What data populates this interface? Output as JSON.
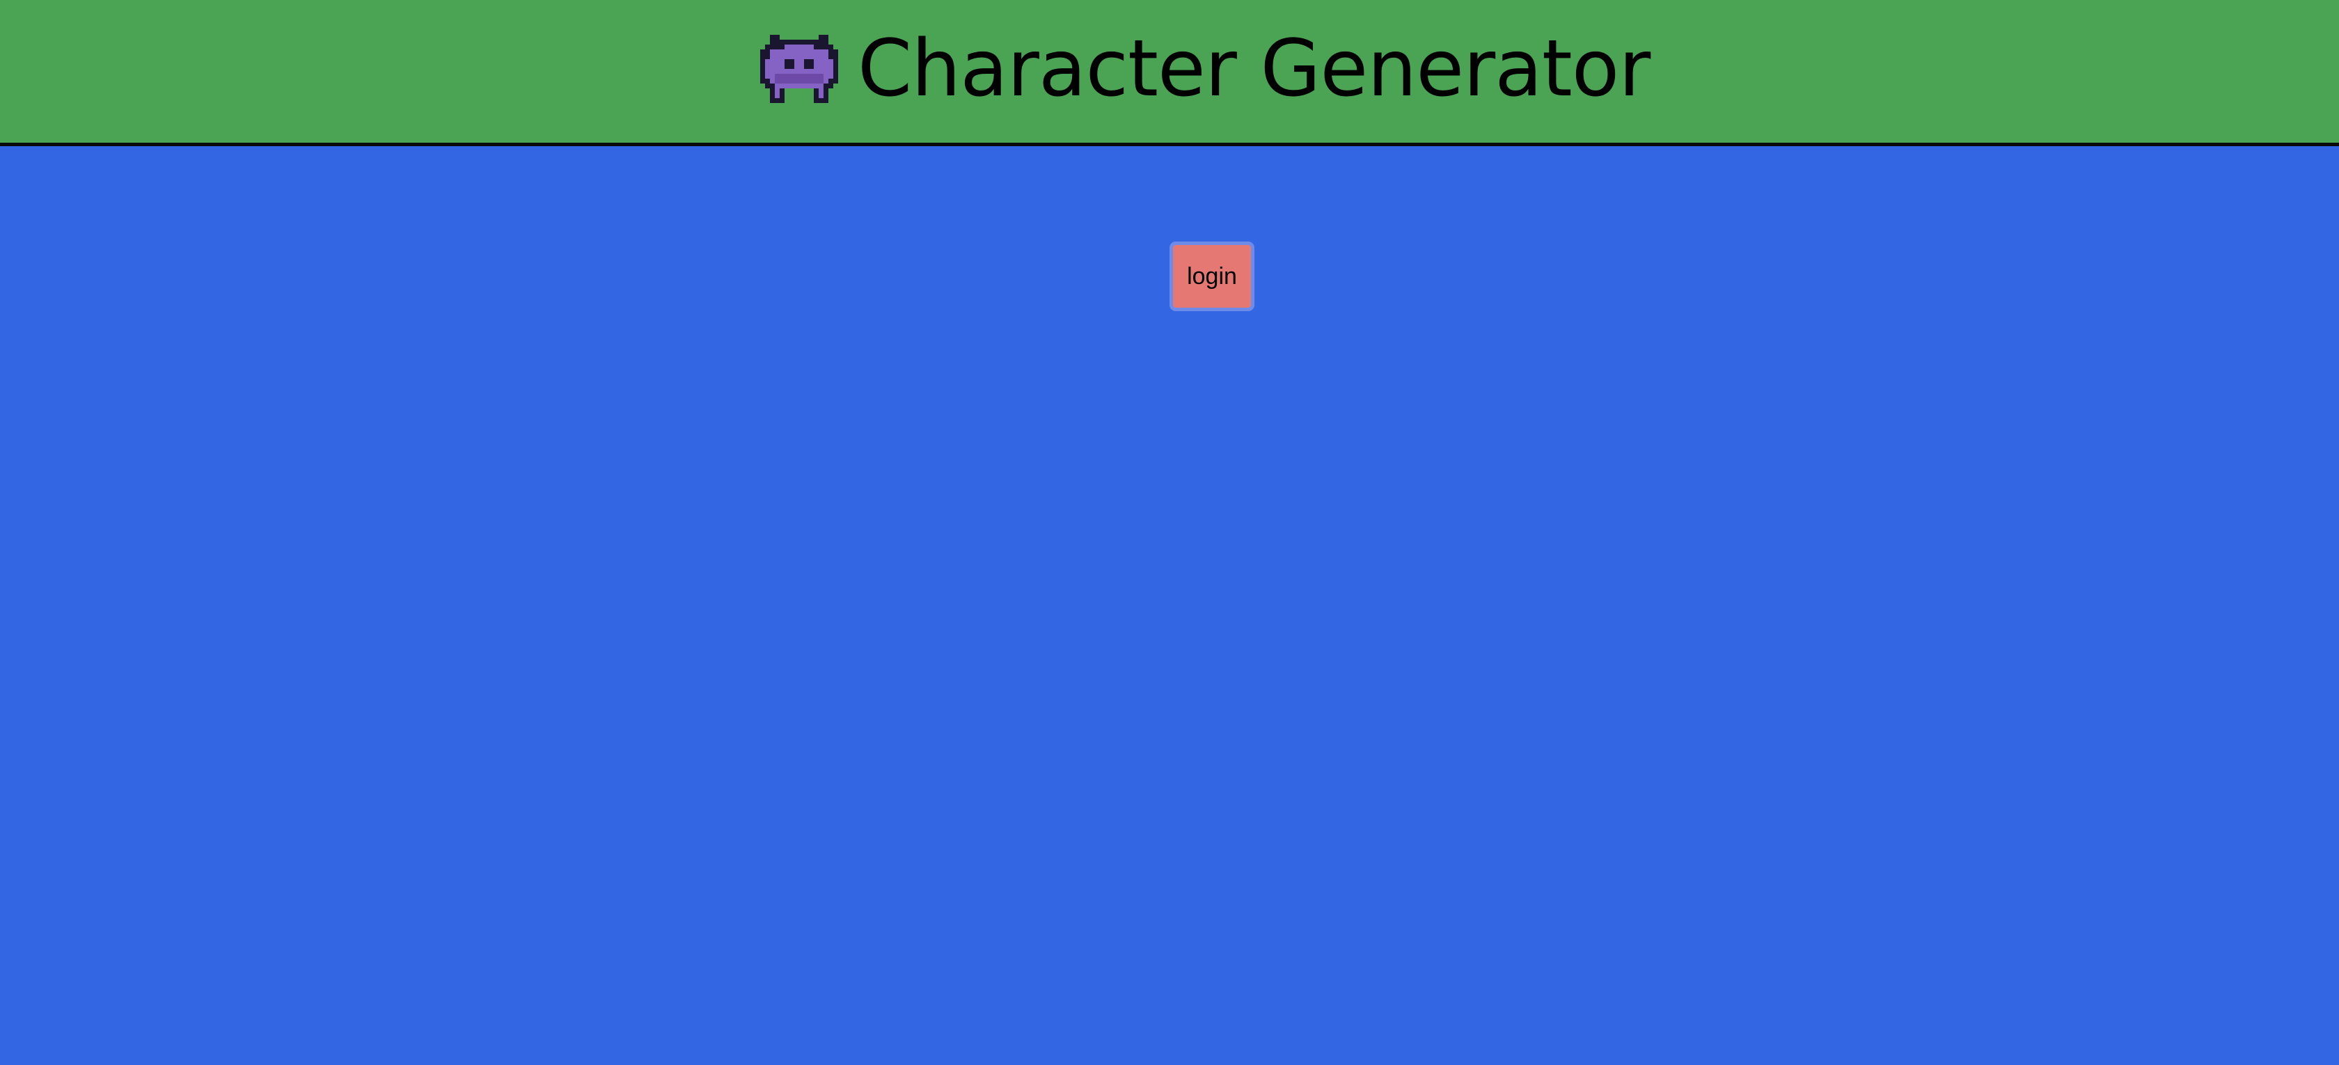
{
  "header": {
    "title": "Character Generator",
    "icon": "alien-monster-icon",
    "background_color": "#4ba354"
  },
  "main": {
    "background_color": "#3366e2",
    "login_button": {
      "label": "login",
      "background_color": "#e57873",
      "border_color": "#6f8bea"
    }
  }
}
